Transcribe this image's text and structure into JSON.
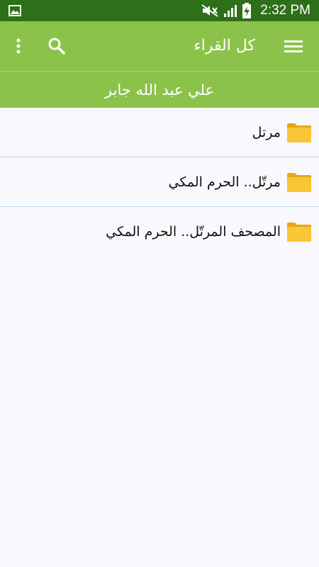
{
  "status_bar": {
    "time": "2:32 PM",
    "left_icon": "image-icon",
    "right_icons": [
      "mute-icon",
      "signal-icon",
      "battery-charging-icon"
    ]
  },
  "app_bar": {
    "title": "كل القراء",
    "menu_icon": "hamburger-menu-icon",
    "search_icon": "search-icon",
    "more_icon": "more-vertical-icon",
    "background": "#8bc34a"
  },
  "subheader": {
    "title": "علي عبد الله جابر"
  },
  "list": {
    "items": [
      {
        "label": "مرتل",
        "icon": "folder-icon"
      },
      {
        "label": "مرتّل.. الحرم المكي",
        "icon": "folder-icon"
      },
      {
        "label": "المصحف المرتّل.. الحرم المكي",
        "icon": "folder-icon"
      }
    ]
  },
  "colors": {
    "status_bar": "#2e6f19",
    "accent": "#8bc34a",
    "folder": "#f5b921",
    "divider": "#b9d6ea"
  }
}
